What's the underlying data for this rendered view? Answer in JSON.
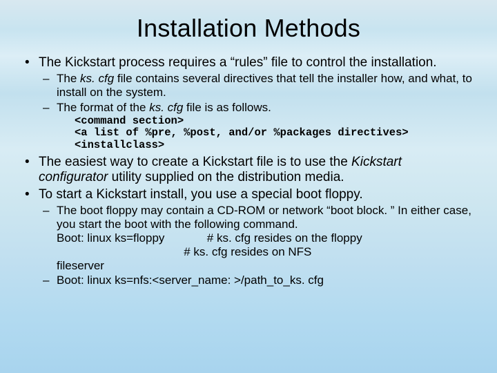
{
  "title": "Installation Methods",
  "b1": {
    "text_a": "The Kickstart process requires a “rules” file to control the installation.",
    "s1_a": "The ",
    "s1_i": "ks. cfg",
    "s1_b": " file contains several directives that tell the installer how, and what, to install on the system.",
    "s2_a": "The format of the ",
    "s2_i": "ks. cfg",
    "s2_b": " file is as follows.",
    "code1": "<command section>",
    "code2": "<a list of %pre, %post, and/or %packages directives>",
    "code3": "<installclass>"
  },
  "b2": {
    "text_a": "The easiest way to create a Kickstart file is to use the ",
    "text_i": "Kickstart configurator",
    "text_b": " utility supplied on the distribution media."
  },
  "b3": {
    "text": "To start a Kickstart install, you use a special boot floppy.",
    "s1_line1": "The boot floppy may contain a CD-ROM or network “boot block. ” In either case, you start the boot with the following command.",
    "s1_cmd1": "Boot: linux ks=floppy             # ks. cfg resides on the floppy",
    "s1_cmd2": "                                       # ks. cfg resides on NFS",
    "s1_tail": "fileserver",
    "s2": "Boot: linux ks=nfs:<server_name: >/path_to_ks. cfg"
  }
}
